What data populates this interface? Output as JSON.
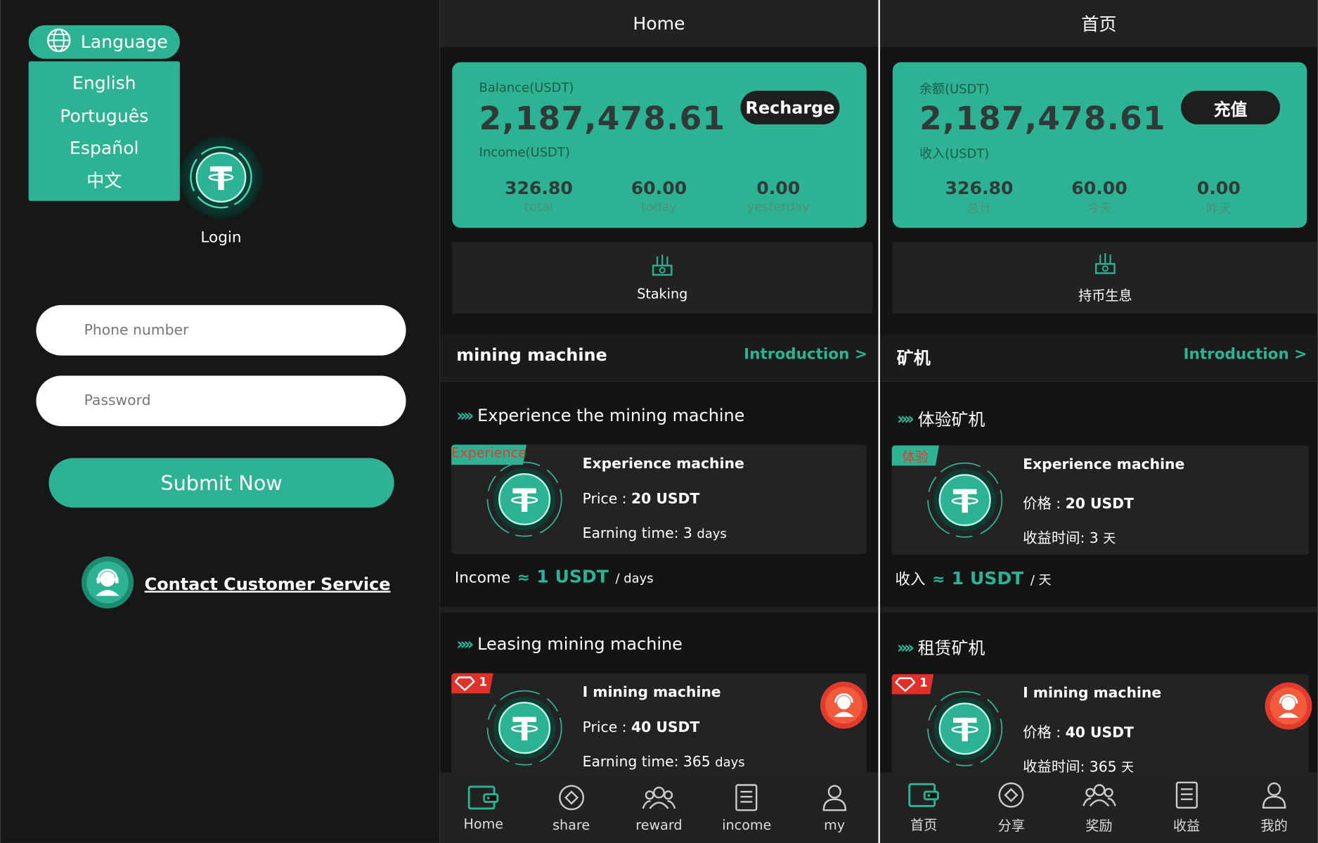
{
  "login": {
    "language_label": "Language",
    "languages": [
      "English",
      "Português",
      "Español",
      "中文"
    ],
    "login_label": "Login",
    "phone_placeholder": "Phone number",
    "password_placeholder": "Password",
    "submit_label": "Submit Now",
    "contact_label": "Contact Customer Service"
  },
  "colors": {
    "accent": "#2db394",
    "background": "#141414",
    "panel": "#222222",
    "danger": "#e0302a"
  },
  "en": {
    "header_title": "Home",
    "balance_label": "Balance(USDT)",
    "balance_value": "2,187,478.61",
    "income_label": "Income(USDT)",
    "recharge_label": "Recharge",
    "stats": [
      {
        "value": "326.80",
        "label": "total"
      },
      {
        "value": "60.00",
        "label": "today"
      },
      {
        "value": "0.00",
        "label": "yesterday"
      }
    ],
    "staking_label": "Staking",
    "section_title": "mining machine",
    "section_link": "Introduction >",
    "experience_title": "Experience the mining machine",
    "experience_tag": "Experience",
    "experience_name": "Experience machine",
    "experience_price_label": "Price :",
    "experience_price": "20 USDT",
    "experience_time_label": "Earning time:",
    "experience_time_value": "3",
    "experience_time_unit": "days",
    "income_prefix": "Income",
    "income_approx": "≈",
    "income_amount": "1 USDT",
    "income_unit": "/ days",
    "leasing_title": "Leasing mining machine",
    "leasing_tag": "1",
    "leasing_name": "I  mining machine",
    "leasing_price_label": "Price :",
    "leasing_price": "40 USDT",
    "leasing_time_label": "Earning time:",
    "leasing_time_value": "365",
    "leasing_time_unit": "days",
    "nav": [
      {
        "label": "Home",
        "icon": "wallet-icon"
      },
      {
        "label": "share",
        "icon": "share-icon"
      },
      {
        "label": "reward",
        "icon": "users-icon"
      },
      {
        "label": "income",
        "icon": "document-icon"
      },
      {
        "label": "my",
        "icon": "user-icon"
      }
    ]
  },
  "zh": {
    "header_title": "首页",
    "balance_label": "余额(USDT)",
    "balance_value": "2,187,478.61",
    "income_label": "收入(USDT)",
    "recharge_label": "充值",
    "stats": [
      {
        "value": "326.80",
        "label": "总计"
      },
      {
        "value": "60.00",
        "label": "今天"
      },
      {
        "value": "0.00",
        "label": "昨天"
      }
    ],
    "staking_label": "持币生息",
    "section_title": "矿机",
    "section_link": "Introduction >",
    "experience_title": "体验矿机",
    "experience_tag": "体验",
    "experience_name": "Experience machine",
    "experience_price_label": "价格 :",
    "experience_price": "20 USDT",
    "experience_time_label": "收益时间:",
    "experience_time_value": "3",
    "experience_time_unit": "天",
    "income_prefix": "收入",
    "income_approx": "≈",
    "income_amount": "1 USDT",
    "income_unit": "/ 天",
    "leasing_title": "租赁矿机",
    "leasing_tag": "1",
    "leasing_name": "I  mining machine",
    "leasing_price_label": "价格 :",
    "leasing_price": "40 USDT",
    "leasing_time_label": "收益时间:",
    "leasing_time_value": "365",
    "leasing_time_unit": "天",
    "nav": [
      {
        "label": "首页",
        "icon": "wallet-icon"
      },
      {
        "label": "分享",
        "icon": "share-icon"
      },
      {
        "label": "奖励",
        "icon": "users-icon"
      },
      {
        "label": "收益",
        "icon": "document-icon"
      },
      {
        "label": "我的",
        "icon": "user-icon"
      }
    ]
  }
}
